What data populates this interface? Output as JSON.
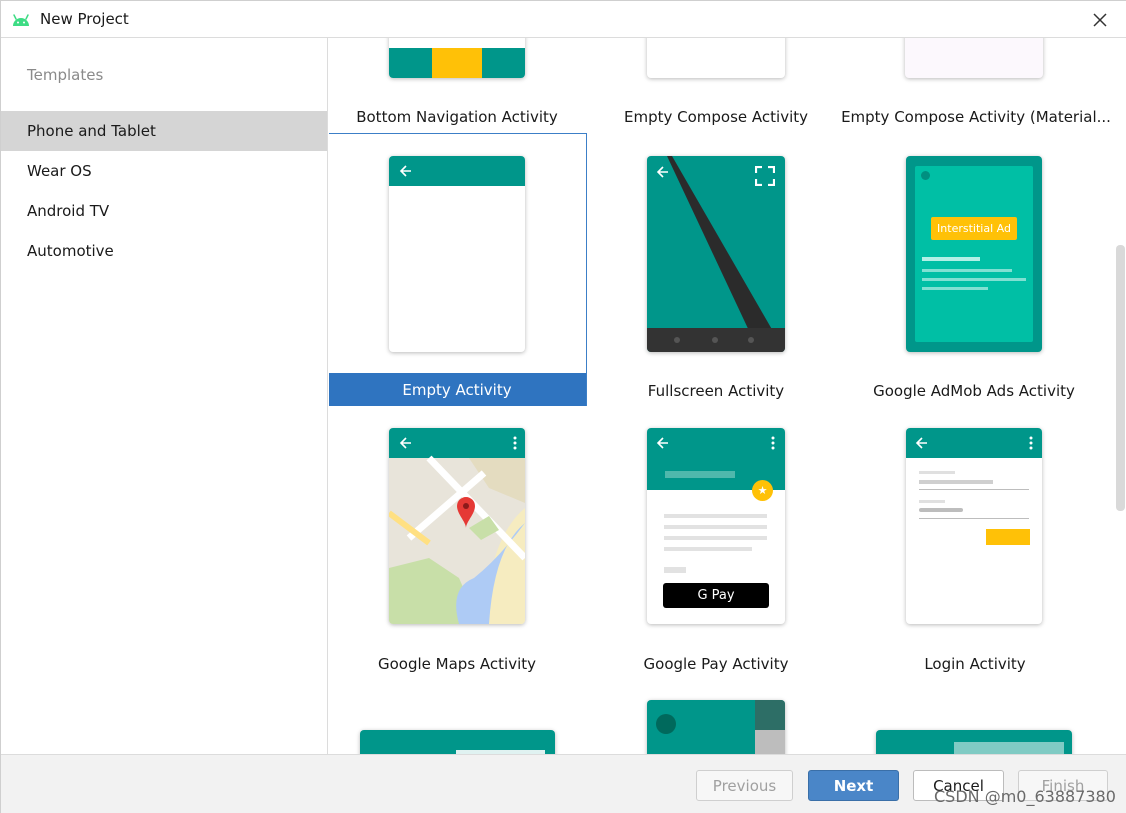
{
  "window": {
    "title": "New Project"
  },
  "sidebar": {
    "heading": "Templates",
    "items": [
      {
        "label": "Phone and Tablet",
        "selected": true
      },
      {
        "label": "Wear OS",
        "selected": false
      },
      {
        "label": "Android TV",
        "selected": false
      },
      {
        "label": "Automotive",
        "selected": false
      }
    ]
  },
  "templates": [
    {
      "label": "Bottom Navigation Activity"
    },
    {
      "label": "Empty Compose Activity"
    },
    {
      "label": "Empty Compose Activity (Material..."
    },
    {
      "label": "Empty Activity",
      "selected": true
    },
    {
      "label": "Fullscreen Activity"
    },
    {
      "label": "Google AdMob Ads Activity",
      "badge": "Interstitial Ad"
    },
    {
      "label": "Google Maps Activity"
    },
    {
      "label": "Google Pay Activity",
      "pay_button": "G Pay"
    },
    {
      "label": "Login Activity"
    }
  ],
  "footer": {
    "previous": "Previous",
    "next": "Next",
    "cancel": "Cancel",
    "finish": "Finish"
  },
  "watermark": "CSDN @m0_63887380",
  "colors": {
    "teal": "#00968a",
    "teal_dark": "#00796b",
    "amber": "#ffc107",
    "selection_blue": "#2f74c0",
    "next_button": "#4a86c8"
  }
}
